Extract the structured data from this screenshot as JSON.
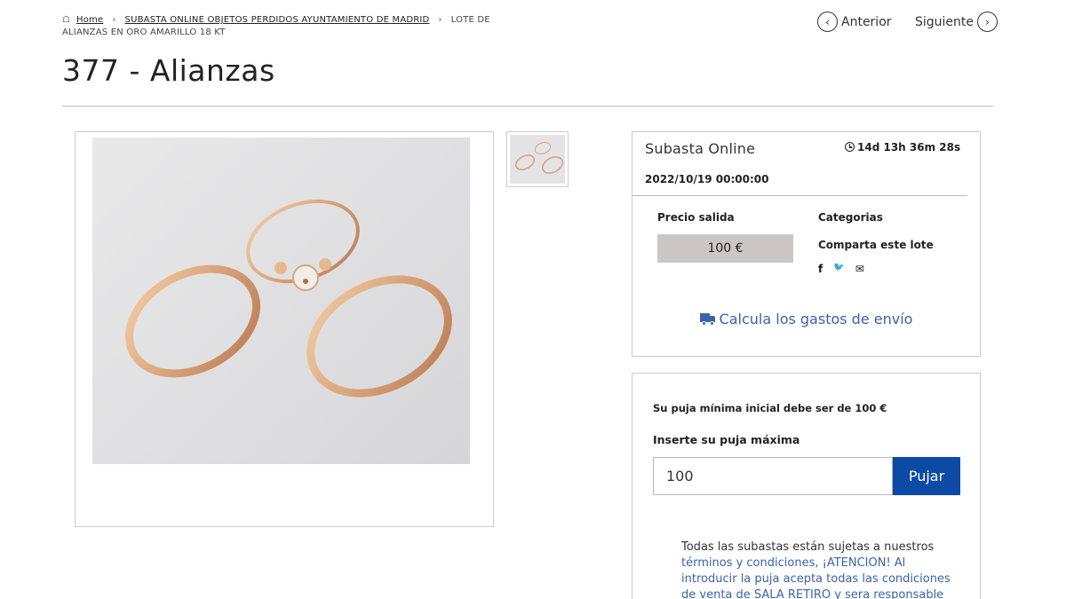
{
  "breadcrumb": {
    "home": "Home",
    "sep1": "›",
    "category": "SUBASTA ONLINE OBJETOS PERDIDOS AYUNTAMIENTO DE MADRID",
    "sep2": "›",
    "current": "LOTE DE ALIANZAS EN ORO AMARILLO 18 KT"
  },
  "nav": {
    "prev_icon": "‹",
    "prev_label": "Anterior",
    "next_label": "Siguiente",
    "next_icon": "›"
  },
  "title": "377 - Alianzas",
  "info": {
    "auction_type": "Subasta Online",
    "countdown": "14d 13h 36m 28s",
    "date": "2022/10/19 00:00:00",
    "price_label": "Precio salida",
    "price_value": "100 €",
    "categories_label": "Categorias",
    "share_label": "Comparta este lote",
    "share_facebook": "f",
    "share_twitter": "🐦",
    "share_email": "✉",
    "shipping_link": "Calcula los gastos de envío"
  },
  "bid": {
    "min_bid_text": "Su puja mínima inicial debe ser de 100 €",
    "max_bid_label": "Inserte su puja máxima",
    "input_value": "100",
    "button_label": "Pujar",
    "terms_prefix": "Todas las subastas están sujetas a nuestros ",
    "terms_link": "términos y condiciones, ¡ATENCION! Al introducir la puja acepta todas las condiciones de venta de SALA RETIRO y sera responsable"
  },
  "colors": {
    "accent": "#0c4aa6",
    "link": "#3b63a7",
    "price_bg": "#cdc6c7"
  }
}
